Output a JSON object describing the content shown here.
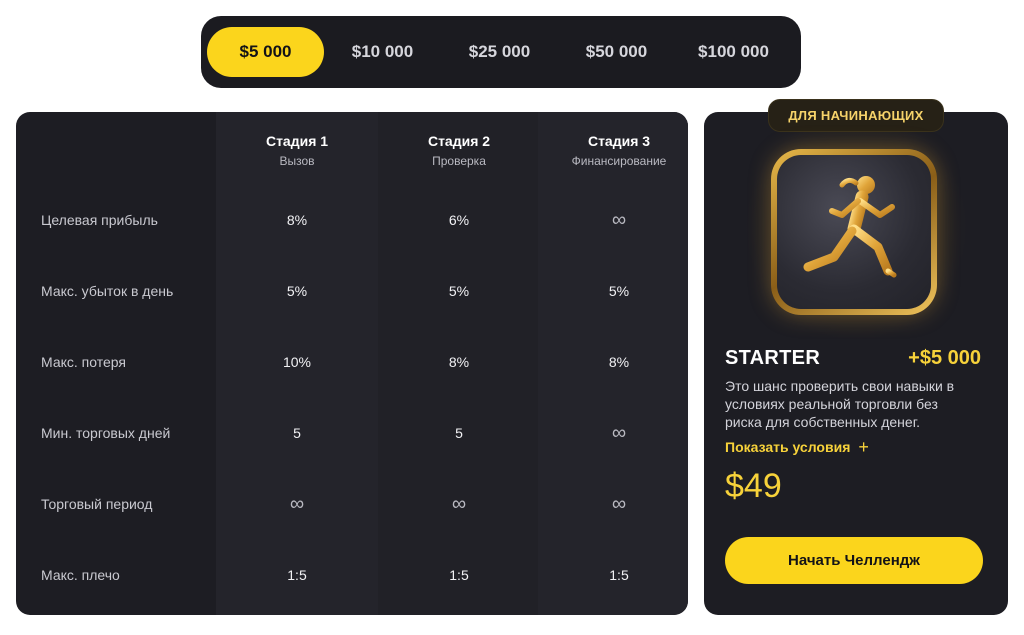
{
  "tabs": [
    {
      "label": "$5 000",
      "active": true
    },
    {
      "label": "$10 000",
      "active": false
    },
    {
      "label": "$25 000",
      "active": false
    },
    {
      "label": "$50 000",
      "active": false
    },
    {
      "label": "$100 000",
      "active": false
    }
  ],
  "stages": [
    {
      "title": "Стадия 1",
      "subtitle": "Вызов"
    },
    {
      "title": "Стадия 2",
      "subtitle": "Проверка"
    },
    {
      "title": "Стадия 3",
      "subtitle": "Финансирование"
    }
  ],
  "rows": [
    {
      "label": "Целевая прибыль",
      "values": [
        "8%",
        "6%",
        "∞"
      ]
    },
    {
      "label": "Макс. убыток в день",
      "values": [
        "5%",
        "5%",
        "5%"
      ]
    },
    {
      "label": "Макс. потеря",
      "values": [
        "10%",
        "8%",
        "8%"
      ]
    },
    {
      "label": "Мин. торговых дней",
      "values": [
        "5",
        "5",
        "∞"
      ]
    },
    {
      "label": "Торговый период",
      "values": [
        "∞",
        "∞",
        "∞"
      ]
    },
    {
      "label": "Макс. плечо",
      "values": [
        "1:5",
        "1:5",
        "1:5"
      ]
    }
  ],
  "plan": {
    "badge": "ДЛЯ НАЧИНАЮЩИХ",
    "emblem_icon": "runner-icon",
    "name": "STARTER",
    "bonus": "+$5 000",
    "description": "Это шанс проверить свои навыки в условиях реальной торговли без риска для собственных денег.",
    "show_terms": "Показать условия",
    "price": "$49",
    "cta": "Начать Челлендж"
  },
  "colors": {
    "accent": "#fbd51c",
    "panel": "#1d1d23",
    "gold": "#f7d23a"
  }
}
